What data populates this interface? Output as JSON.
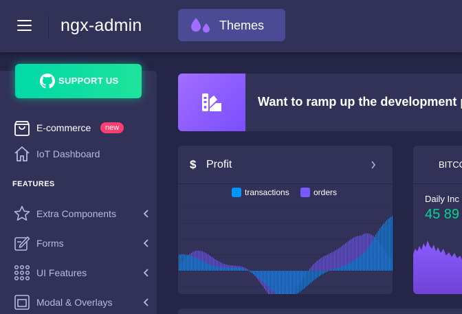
{
  "header": {
    "logo": "ngx-admin",
    "theme_button_label": "Themes",
    "icons": {
      "menu": "hamburger-icon",
      "theme": "droplets-icon"
    }
  },
  "sidebar": {
    "support_button": {
      "label": "SUPPORT US",
      "icon": "github-icon"
    },
    "items": [
      {
        "label": "E-commerce",
        "icon": "shopping-bag-icon",
        "badge": "new",
        "active": true
      },
      {
        "label": "IoT Dashboard",
        "icon": "home-icon"
      }
    ],
    "section_title": "FEATURES",
    "feature_items": [
      {
        "label": "Extra Components",
        "icon": "star-icon"
      },
      {
        "label": "Forms",
        "icon": "edit-icon"
      },
      {
        "label": "UI Features",
        "icon": "keypad-icon"
      },
      {
        "label": "Modal & Overlays",
        "icon": "browser-icon"
      }
    ]
  },
  "banner": {
    "text": "Want to ramp up the development pro",
    "icon": "color-palette-icon"
  },
  "profit_card": {
    "currency_symbol": "$",
    "title": "Profit",
    "legend": [
      {
        "label": "transactions",
        "color": "#0095ff"
      },
      {
        "label": "orders",
        "color": "#7659ff"
      }
    ]
  },
  "bitcoin_card": {
    "title": "BITCO",
    "daily_label": "Daily Inc",
    "value": "45 89",
    "value_color": "#00d68f"
  },
  "colors": {
    "background": "#252547",
    "card": "#323259",
    "accent_purple": "#a16eff",
    "success": "#00d68f",
    "danger": "#ff3d71"
  }
}
